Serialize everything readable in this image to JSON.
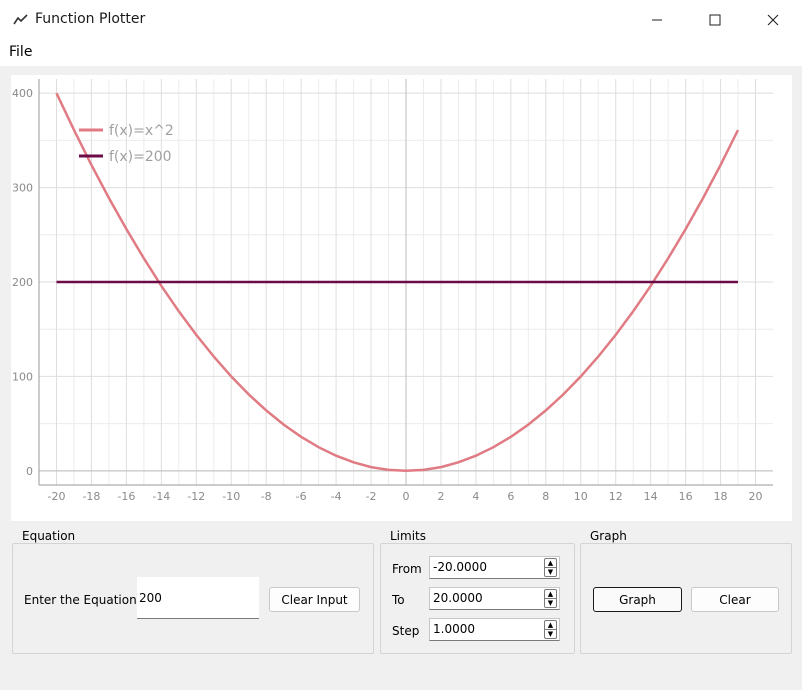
{
  "window": {
    "title": "Function Plotter",
    "icon": "chart-line-icon",
    "controls": [
      "minimize-icon",
      "maximize-icon",
      "close-icon"
    ]
  },
  "menu": {
    "file_label": "File"
  },
  "chart_data": {
    "type": "line",
    "x": [
      -20,
      -19,
      -18,
      -17,
      -16,
      -15,
      -14,
      -13,
      -12,
      -11,
      -10,
      -9,
      -8,
      -7,
      -6,
      -5,
      -4,
      -3,
      -2,
      -1,
      0,
      1,
      2,
      3,
      4,
      5,
      6,
      7,
      8,
      9,
      10,
      11,
      12,
      13,
      14,
      15,
      16,
      17,
      18,
      19
    ],
    "series": [
      {
        "name": "f(x)=x^2",
        "color": "#e07a83",
        "values": [
          400,
          361,
          324,
          289,
          256,
          225,
          196,
          169,
          144,
          121,
          100,
          81,
          64,
          49,
          36,
          25,
          16,
          9,
          4,
          1,
          0,
          1,
          4,
          9,
          16,
          25,
          36,
          49,
          64,
          81,
          100,
          121,
          144,
          169,
          196,
          225,
          256,
          289,
          324,
          361
        ]
      },
      {
        "name": "f(x)=200",
        "color": "#6b0b47",
        "values": [
          200,
          200,
          200,
          200,
          200,
          200,
          200,
          200,
          200,
          200,
          200,
          200,
          200,
          200,
          200,
          200,
          200,
          200,
          200,
          200,
          200,
          200,
          200,
          200,
          200,
          200,
          200,
          200,
          200,
          200,
          200,
          200,
          200,
          200,
          200,
          200,
          200,
          200,
          200,
          200
        ]
      }
    ],
    "xlim": [
      -21,
      21
    ],
    "ylim": [
      -15,
      415
    ],
    "xticks": [
      -20,
      -18,
      -16,
      -14,
      -12,
      -10,
      -8,
      -6,
      -4,
      -2,
      0,
      2,
      4,
      6,
      8,
      10,
      12,
      14,
      16,
      18,
      20
    ],
    "yticks": [
      0,
      100,
      200,
      300,
      400
    ],
    "grid": true,
    "legend": "top-left"
  },
  "equation": {
    "group_title": "Equation",
    "label": "Enter the Equation",
    "value": "200",
    "clear_input_label": "Clear Input"
  },
  "limits": {
    "group_title": "Limits",
    "from_label": "From",
    "from_value": "-20.0000",
    "to_label": "To",
    "to_value": "20.0000",
    "step_label": "Step",
    "step_value": "1.0000"
  },
  "graph": {
    "group_title": "Graph",
    "graph_label": "Graph",
    "clear_label": "Clear"
  }
}
